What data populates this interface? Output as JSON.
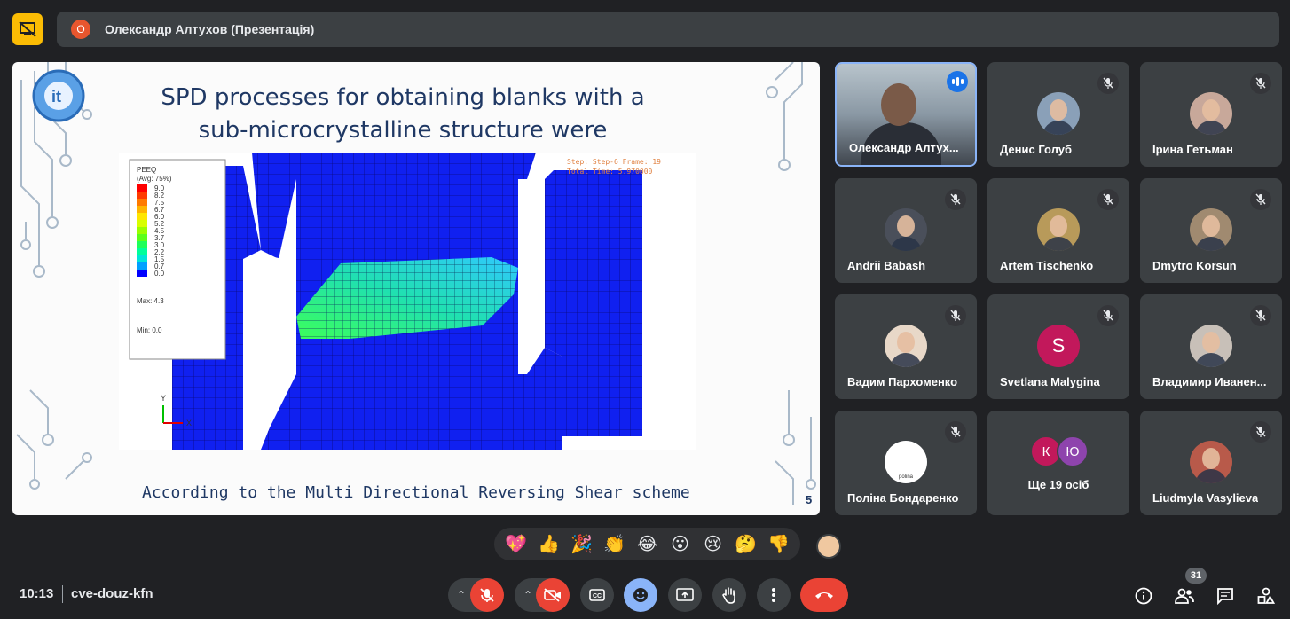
{
  "header": {
    "badge_letter": "О",
    "title": "Олександр Алтухов (Презентація)"
  },
  "slide": {
    "title": "SPD processes for obtaining blanks with a sub-microcrystalline structure were investigated",
    "footer": "According to the Multi Directional Reversing Shear scheme",
    "page_number": "5",
    "sim": {
      "legend_title": "PEEQ",
      "legend_sub": "(Avg: 75%)",
      "legend_values": [
        "9.0",
        "8.2",
        "7.5",
        "6.7",
        "6.0",
        "5.2",
        "4.5",
        "3.7",
        "3.0",
        "2.2",
        "1.5",
        "0.7",
        "0.0"
      ],
      "legend_colors": [
        "#ff0000",
        "#ff3b00",
        "#ff7a00",
        "#ffb400",
        "#ffe600",
        "#d8ff00",
        "#9aff00",
        "#5cff1a",
        "#1eff5a",
        "#00ff9a",
        "#00e6d8",
        "#00a0ff",
        "#0000ff"
      ],
      "max_label": "Max: 4.3",
      "min_label": "Min: 0.0",
      "step_text": "Step: Step-6    Frame: 19",
      "time_text": "Total Time: 5.970000",
      "axis_y": "Y",
      "axis_x": "X"
    }
  },
  "participants": [
    {
      "name": "Олександр Алтух...",
      "active": true,
      "speaking": true,
      "avatar_color": "#7a6a58"
    },
    {
      "name": "Денис Голуб",
      "avatar_color": "#8aa0b8"
    },
    {
      "name": "Ірина Гетьман",
      "avatar_color": "#c8a89a"
    },
    {
      "name": "Andrii Babash",
      "avatar_color": "#4a4f5a"
    },
    {
      "name": "Artem Tischenko",
      "avatar_color": "#b89a5a"
    },
    {
      "name": "Dmytro Korsun",
      "avatar_color": "#a08a70"
    },
    {
      "name": "Вадим Пархоменко",
      "avatar_color": "#e8d8c8"
    },
    {
      "name": "Svetlana Malygina",
      "letter": "S",
      "avatar_color": "#c2185b"
    },
    {
      "name": "Владимир Иванен...",
      "avatar_color": "#c8c0b8"
    },
    {
      "name": "Поліна Бондаренко",
      "avatar_color": "#ffffff",
      "avatar_text": "polina"
    },
    {
      "name": "Ще 19 осіб",
      "more": true,
      "letters": [
        "К",
        "Ю"
      ],
      "letter_colors": [
        "#c2185b",
        "#8e44ad"
      ]
    },
    {
      "name": "Liudmyla Vasylieva",
      "avatar_color": "#b85a4a"
    }
  ],
  "reactions": [
    "💖",
    "👍",
    "🎉",
    "👏",
    "😂",
    "😮",
    "😢",
    "🤔",
    "👎"
  ],
  "footer": {
    "time": "10:13",
    "meeting_code": "cve-douz-kfn",
    "people_count": "31"
  }
}
